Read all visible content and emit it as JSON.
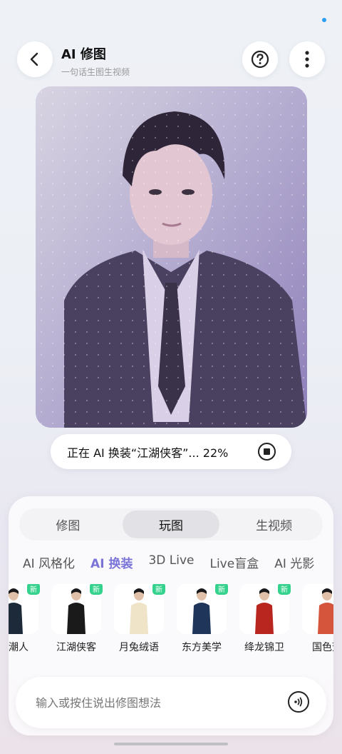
{
  "header": {
    "title": "AI 修图",
    "subtitle": "一句话生图生视频"
  },
  "progress": {
    "text": "正在 AI 换装“江湖侠客”... 22%",
    "percent": 22
  },
  "tabs": [
    {
      "label": "修图",
      "active": false
    },
    {
      "label": "玩图",
      "active": true
    },
    {
      "label": "生视频",
      "active": false
    }
  ],
  "subtabs": [
    {
      "label": "AI 风格化",
      "active": false
    },
    {
      "label": "AI 换装",
      "active": true
    },
    {
      "label": "3D Live",
      "active": false
    },
    {
      "label": "Live盲盒",
      "active": false
    },
    {
      "label": "AI 光影",
      "active": false
    }
  ],
  "styles": [
    {
      "label": "代潮人",
      "new": true,
      "outfit": "#1c2a3a"
    },
    {
      "label": "江湖侠客",
      "new": true,
      "outfit": "#1a1a1a"
    },
    {
      "label": "月兔绒语",
      "new": true,
      "outfit": "#efe3c8"
    },
    {
      "label": "东方美学",
      "new": true,
      "outfit": "#1f3559"
    },
    {
      "label": "绛龙锦卫",
      "new": true,
      "outfit": "#b8261f"
    },
    {
      "label": "国色芳",
      "new": false,
      "outfit": "#d4553c"
    }
  ],
  "input": {
    "placeholder": "输入或按住说出修图想法"
  },
  "colors": {
    "accent": "#7b74d8",
    "new_badge": "#34d28c",
    "status_dot": "#2a9df4"
  }
}
